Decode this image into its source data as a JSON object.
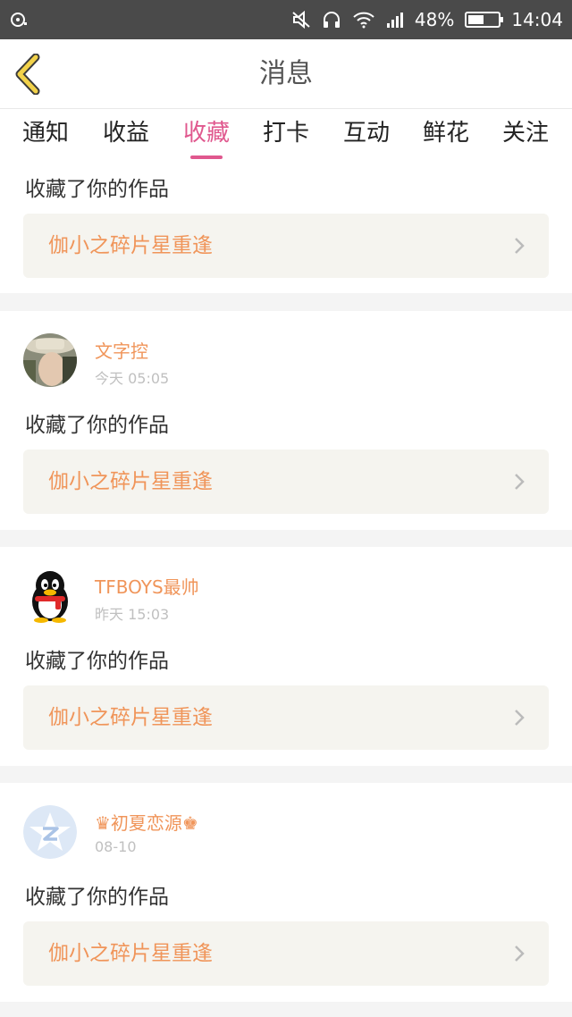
{
  "status": {
    "battery": "48%",
    "time": "14:04"
  },
  "nav": {
    "title": "消息"
  },
  "tabs": [
    {
      "label": "通知"
    },
    {
      "label": "收益"
    },
    {
      "label": "收藏"
    },
    {
      "label": "打卡"
    },
    {
      "label": "互动"
    },
    {
      "label": "鲜花"
    },
    {
      "label": "关注"
    }
  ],
  "active_tab": "收藏",
  "top_card": {
    "action": "收藏了你的作品",
    "work_title": "伽小之碎片星重逢"
  },
  "items": [
    {
      "name": "文字控",
      "time": "今天 05:05",
      "action": "收藏了你的作品",
      "work_title": "伽小之碎片星重逢",
      "avatar": "man-hat-avatar"
    },
    {
      "name": "TFBOYS最帅",
      "time": "昨天 15:03",
      "action": "收藏了你的作品",
      "work_title": "伽小之碎片星重逢",
      "avatar": "qq-penguin-avatar"
    },
    {
      "name": "♛初夏恋源♚",
      "time": "08-10",
      "action": "收藏了你的作品",
      "work_title": "伽小之碎片星重逢",
      "avatar": "qzone-star-avatar"
    }
  ],
  "colors": {
    "accent": "#e0588e",
    "username": "#f0955a",
    "back_arrow": "#f2d24a"
  }
}
